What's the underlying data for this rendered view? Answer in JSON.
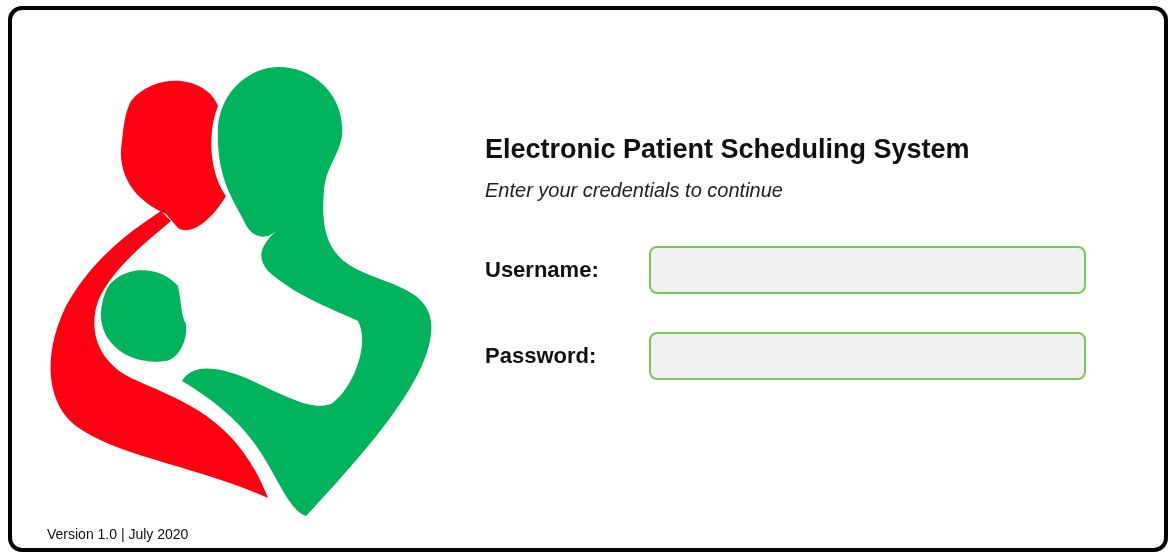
{
  "login": {
    "title": "Electronic Patient Scheduling System",
    "subtitle": "Enter your credentials to continue",
    "fields": [
      {
        "label": "Username:"
      },
      {
        "label": "Password:"
      }
    ]
  },
  "footer": {
    "version": "Version 1.0 | July 2020"
  }
}
